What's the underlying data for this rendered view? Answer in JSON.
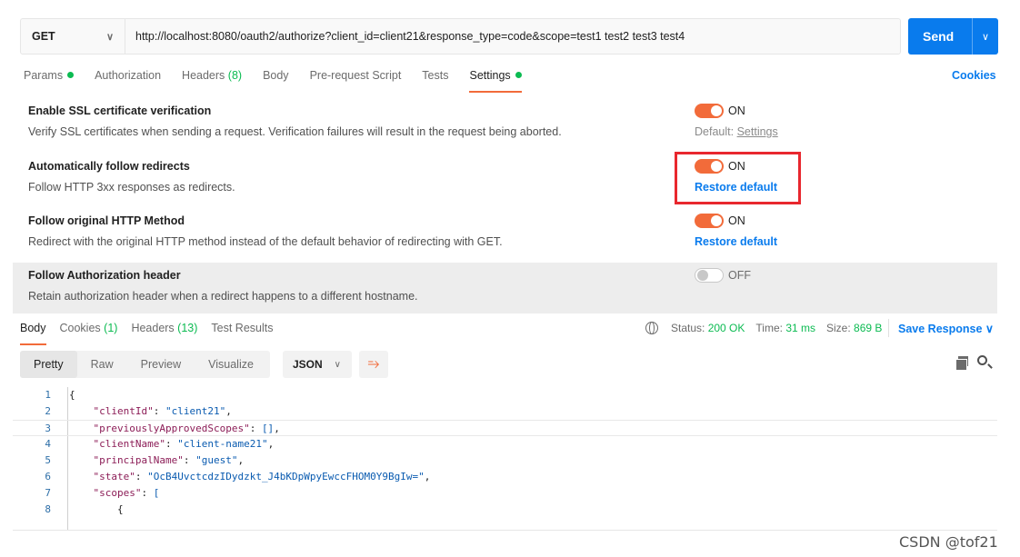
{
  "request": {
    "method": "GET",
    "url": "http://localhost:8080/oauth2/authorize?client_id=client21&response_type=code&scope=test1 test2 test3 test4",
    "send_label": "Send"
  },
  "tabs": [
    {
      "label": "Params",
      "dot": true
    },
    {
      "label": "Authorization"
    },
    {
      "label": "Headers",
      "count": "(8)"
    },
    {
      "label": "Body"
    },
    {
      "label": "Pre-request Script"
    },
    {
      "label": "Tests"
    },
    {
      "label": "Settings",
      "dot": true,
      "active": true
    }
  ],
  "cookies_label": "Cookies",
  "settings": [
    {
      "title": "Enable SSL certificate verification",
      "desc": "Verify SSL certificates when sending a request. Verification failures will result in the request being aborted.",
      "state": "ON",
      "default_prefix": "Default:",
      "default_link": "Settings"
    },
    {
      "title": "Automatically follow redirects",
      "desc": "Follow HTTP 3xx responses as redirects.",
      "state": "ON",
      "restore": "Restore default"
    },
    {
      "title": "Follow original HTTP Method",
      "desc": "Redirect with the original HTTP method instead of the default behavior of redirecting with GET.",
      "state": "ON",
      "restore": "Restore default"
    },
    {
      "title": "Follow Authorization header",
      "desc": "Retain authorization header when a redirect happens to a different hostname.",
      "state": "OFF"
    }
  ],
  "response": {
    "tabs": [
      {
        "label": "Body",
        "active": true
      },
      {
        "label": "Cookies",
        "count": "(1)"
      },
      {
        "label": "Headers",
        "count": "(13)"
      },
      {
        "label": "Test Results"
      }
    ],
    "status_label": "Status:",
    "status_value": "200 OK",
    "time_label": "Time:",
    "time_value": "31 ms",
    "size_label": "Size:",
    "size_value": "869 B",
    "save_label": "Save Response",
    "view_modes": [
      "Pretty",
      "Raw",
      "Preview",
      "Visualize"
    ],
    "format": "JSON"
  },
  "code_lines": [
    {
      "n": "1",
      "text": "{"
    },
    {
      "n": "2",
      "key": "\"clientId\"",
      "val": "\"client21\"",
      "tail": ","
    },
    {
      "n": "3",
      "key": "\"previouslyApprovedScopes\"",
      "val": "[]",
      "tail": ","
    },
    {
      "n": "4",
      "key": "\"clientName\"",
      "val": "\"client-name21\"",
      "tail": ","
    },
    {
      "n": "5",
      "key": "\"principalName\"",
      "val": "\"guest\"",
      "tail": ","
    },
    {
      "n": "6",
      "key": "\"state\"",
      "val": "\"OcB4UvctcdzIDydzkt_J4bKDpWpyEwccFHOM0Y9BgIw=\"",
      "tail": ","
    },
    {
      "n": "7",
      "key": "\"scopes\"",
      "val": "[",
      "tail": ""
    },
    {
      "n": "8",
      "text": "        {"
    }
  ],
  "watermark": "CSDN @tof21",
  "colors": {
    "accent": "#f26b3a",
    "link": "#097bed",
    "status_ok": "#0cbb52",
    "highlight_box": "#e8272e"
  }
}
